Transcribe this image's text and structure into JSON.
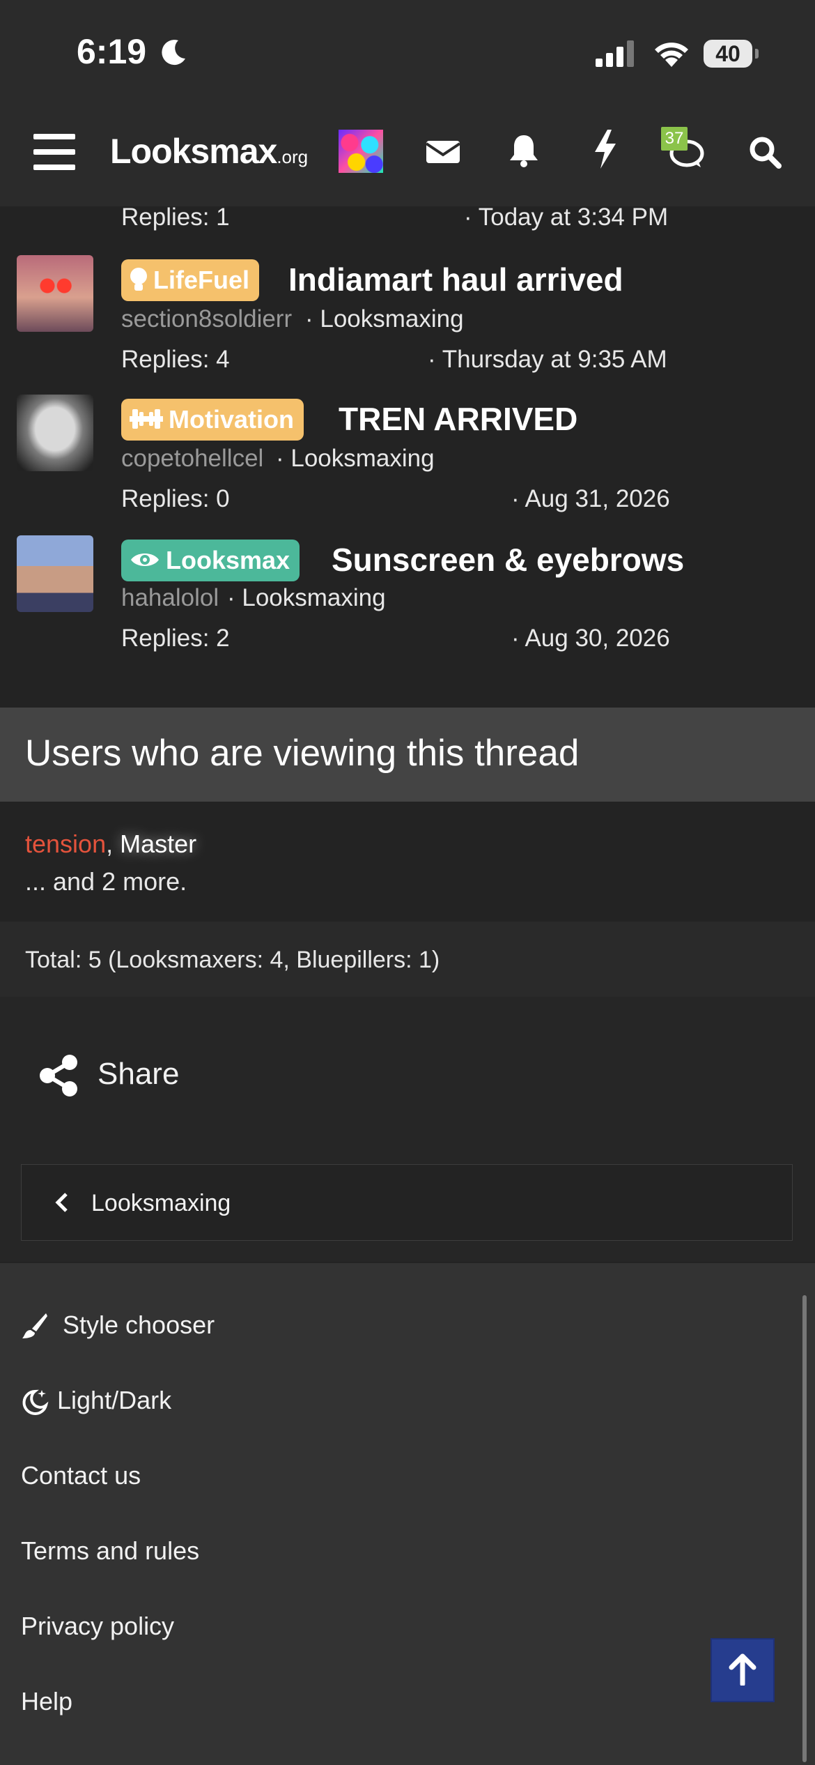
{
  "status_bar": {
    "time": "6:19",
    "battery": "40"
  },
  "nav": {
    "logo_main": "Looksmax",
    "logo_suffix": ".org",
    "conversations_badge": "37"
  },
  "threads": [
    {
      "replies": "Replies: 1",
      "date": "· Today at 3:34 PM"
    },
    {
      "tag": "LifeFuel",
      "tag_color": "#f5c16c",
      "title": "Indiamart haul arrived",
      "author": "section8soldierr",
      "forum": "· Looksmaxing",
      "replies": "Replies: 4",
      "date": "· Thursday at 9:35 AM"
    },
    {
      "tag": "Motivation",
      "tag_color": "#f5c16c",
      "title": "TREN ARRIVED",
      "author": "copetohellcel",
      "forum": "· Looksmaxing",
      "replies": "Replies: 0",
      "date": "· Aug 31, 2026"
    },
    {
      "tag": "Looksmax",
      "tag_color": "#4cb89a",
      "title": "Sunscreen & eyebrows",
      "author": "hahalolol",
      "forum": "· Looksmaxing",
      "replies": "Replies: 2",
      "date": "· Aug 30, 2026"
    }
  ],
  "viewers": {
    "title": "Users who are viewing this thread",
    "user1": "tension",
    "separator": ",",
    "user2": "Master",
    "more": "... and 2 more.",
    "total": "Total: 5 (Looksmaxers: 4, Bluepillers: 1)"
  },
  "share": {
    "label": "Share"
  },
  "breadcrumb": {
    "label": "Looksmaxing"
  },
  "footer": {
    "style_chooser": "Style chooser",
    "light_dark": "Light/Dark",
    "contact": "Contact us",
    "terms": "Terms and rules",
    "privacy": "Privacy policy",
    "help": "Help"
  },
  "colors": {
    "accent_red": "#e4533c",
    "tag_yellow": "#f5c16c",
    "tag_green": "#4cb89a",
    "scroll_top_blue": "#263d8e"
  }
}
